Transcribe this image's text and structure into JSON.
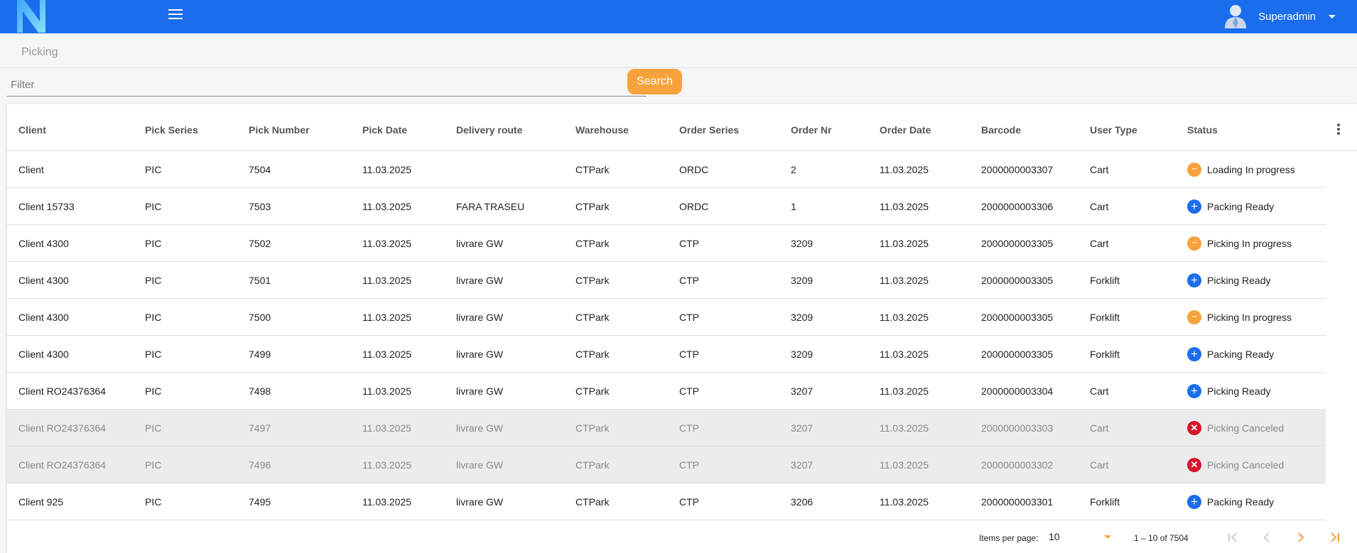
{
  "header": {
    "user_name": "Superadmin",
    "brand_color": "#1a6ded",
    "accent_color": "#f7a23b"
  },
  "breadcrumb": {
    "current": "Picking"
  },
  "filter": {
    "placeholder": "Filter",
    "value": "",
    "search_label": "Search"
  },
  "table": {
    "columns": [
      "Client",
      "Pick Series",
      "Pick Number",
      "Pick Date",
      "Delivery route",
      "Warehouse",
      "Order Series",
      "Order Nr",
      "Order Date",
      "Barcode",
      "User Type",
      "Status"
    ],
    "rows": [
      {
        "client": "Client",
        "pick_series": "PIC",
        "pick_number": "7504",
        "pick_date": "11.03.2025",
        "route": "",
        "warehouse": "CTPark",
        "order_series": "ORDC",
        "order_nr": "2",
        "order_date": "11.03.2025",
        "barcode": "2000000003307",
        "user_type": "Cart",
        "status": "Loading In progress",
        "status_kind": "progress"
      },
      {
        "client": "Client 15733",
        "pick_series": "PIC",
        "pick_number": "7503",
        "pick_date": "11.03.2025",
        "route": "FARA TRASEU",
        "warehouse": "CTPark",
        "order_series": "ORDC",
        "order_nr": "1",
        "order_date": "11.03.2025",
        "barcode": "2000000003306",
        "user_type": "Cart",
        "status": "Packing Ready",
        "status_kind": "ready"
      },
      {
        "client": "Client 4300",
        "pick_series": "PIC",
        "pick_number": "7502",
        "pick_date": "11.03.2025",
        "route": "livrare GW",
        "warehouse": "CTPark",
        "order_series": "CTP",
        "order_nr": "3209",
        "order_date": "11.03.2025",
        "barcode": "2000000003305",
        "user_type": "Cart",
        "status": "Picking In progress",
        "status_kind": "progress"
      },
      {
        "client": "Client 4300",
        "pick_series": "PIC",
        "pick_number": "7501",
        "pick_date": "11.03.2025",
        "route": "livrare GW",
        "warehouse": "CTPark",
        "order_series": "CTP",
        "order_nr": "3209",
        "order_date": "11.03.2025",
        "barcode": "2000000003305",
        "user_type": "Forklift",
        "status": "Picking Ready",
        "status_kind": "ready"
      },
      {
        "client": "Client 4300",
        "pick_series": "PIC",
        "pick_number": "7500",
        "pick_date": "11.03.2025",
        "route": "livrare GW",
        "warehouse": "CTPark",
        "order_series": "CTP",
        "order_nr": "3209",
        "order_date": "11.03.2025",
        "barcode": "2000000003305",
        "user_type": "Forklift",
        "status": "Picking In progress",
        "status_kind": "progress"
      },
      {
        "client": "Client 4300",
        "pick_series": "PIC",
        "pick_number": "7499",
        "pick_date": "11.03.2025",
        "route": "livrare GW",
        "warehouse": "CTPark",
        "order_series": "CTP",
        "order_nr": "3209",
        "order_date": "11.03.2025",
        "barcode": "2000000003305",
        "user_type": "Forklift",
        "status": "Packing Ready",
        "status_kind": "ready"
      },
      {
        "client": "Client RO24376364",
        "pick_series": "PIC",
        "pick_number": "7498",
        "pick_date": "11.03.2025",
        "route": "livrare GW",
        "warehouse": "CTPark",
        "order_series": "CTP",
        "order_nr": "3207",
        "order_date": "11.03.2025",
        "barcode": "2000000003304",
        "user_type": "Cart",
        "status": "Picking Ready",
        "status_kind": "ready"
      },
      {
        "client": "Client RO24376364",
        "pick_series": "PIC",
        "pick_number": "7497",
        "pick_date": "11.03.2025",
        "route": "livrare GW",
        "warehouse": "CTPark",
        "order_series": "CTP",
        "order_nr": "3207",
        "order_date": "11.03.2025",
        "barcode": "2000000003303",
        "user_type": "Cart",
        "status": "Picking Canceled",
        "status_kind": "canceled"
      },
      {
        "client": "Client RO24376364",
        "pick_series": "PIC",
        "pick_number": "7496",
        "pick_date": "11.03.2025",
        "route": "livrare GW",
        "warehouse": "CTPark",
        "order_series": "CTP",
        "order_nr": "3207",
        "order_date": "11.03.2025",
        "barcode": "2000000003302",
        "user_type": "Cart",
        "status": "Picking Canceled",
        "status_kind": "canceled"
      },
      {
        "client": "Client 925",
        "pick_series": "PIC",
        "pick_number": "7495",
        "pick_date": "11.03.2025",
        "route": "livrare GW",
        "warehouse": "CTPark",
        "order_series": "CTP",
        "order_nr": "3206",
        "order_date": "11.03.2025",
        "barcode": "2000000003301",
        "user_type": "Forklift",
        "status": "Packing Ready",
        "status_kind": "ready"
      }
    ]
  },
  "pagination": {
    "items_per_page_label": "Items per page:",
    "items_per_page": "10",
    "range": "1 – 10 of 7504"
  }
}
